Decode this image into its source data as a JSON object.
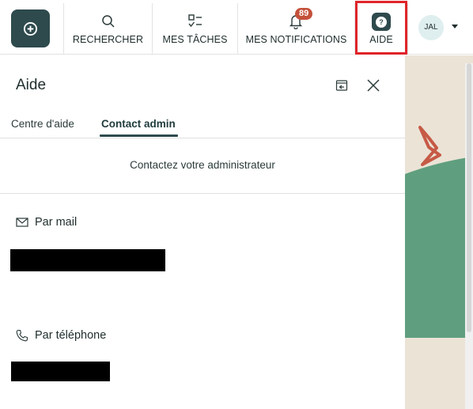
{
  "colors": {
    "primary": "#2e4a4d",
    "badge": "#c4513a",
    "highlight_border": "#e0242a",
    "map_green": "#5f9f7f",
    "map_sand": "#ebe3d6",
    "accent_red_shape": "#c65a46"
  },
  "topbar": {
    "create_icon": "plus-in-rounded-square-icon",
    "search_label": "RECHERCHER",
    "tasks_label": "MES TÂCHES",
    "notifications_label": "MES NOTIFICATIONS",
    "notifications_count": "89",
    "help_label": "AIDE",
    "avatar_initials": "JAL"
  },
  "panel": {
    "title": "Aide",
    "tabs": [
      {
        "label": "Centre d'aide",
        "active": false
      },
      {
        "label": "Contact admin",
        "active": true
      }
    ],
    "contact_text": "Contactez votre administrateur",
    "mail_heading": "Par mail",
    "phone_heading": "Par téléphone"
  }
}
